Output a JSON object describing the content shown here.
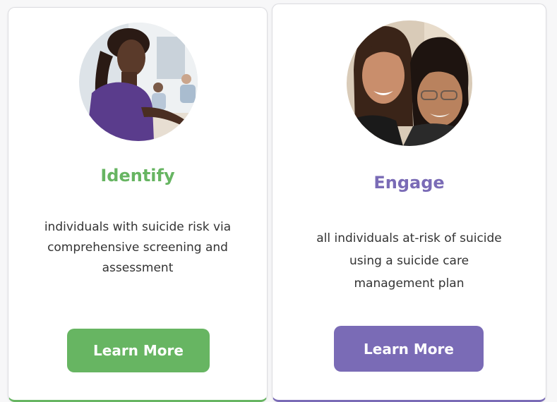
{
  "cards": [
    {
      "title": "Identify",
      "description": "individuals with suicide risk via comprehensive screening and assessment",
      "button_label": "Learn More",
      "accent_color": "#67b562",
      "photo_icon": "nurse-photo"
    },
    {
      "title": "Engage",
      "description": "all individuals at-risk of suicide using a suicide care management plan",
      "button_label": "Learn More",
      "accent_color": "#7a6bb6",
      "photo_icon": "two-women-photo"
    }
  ]
}
